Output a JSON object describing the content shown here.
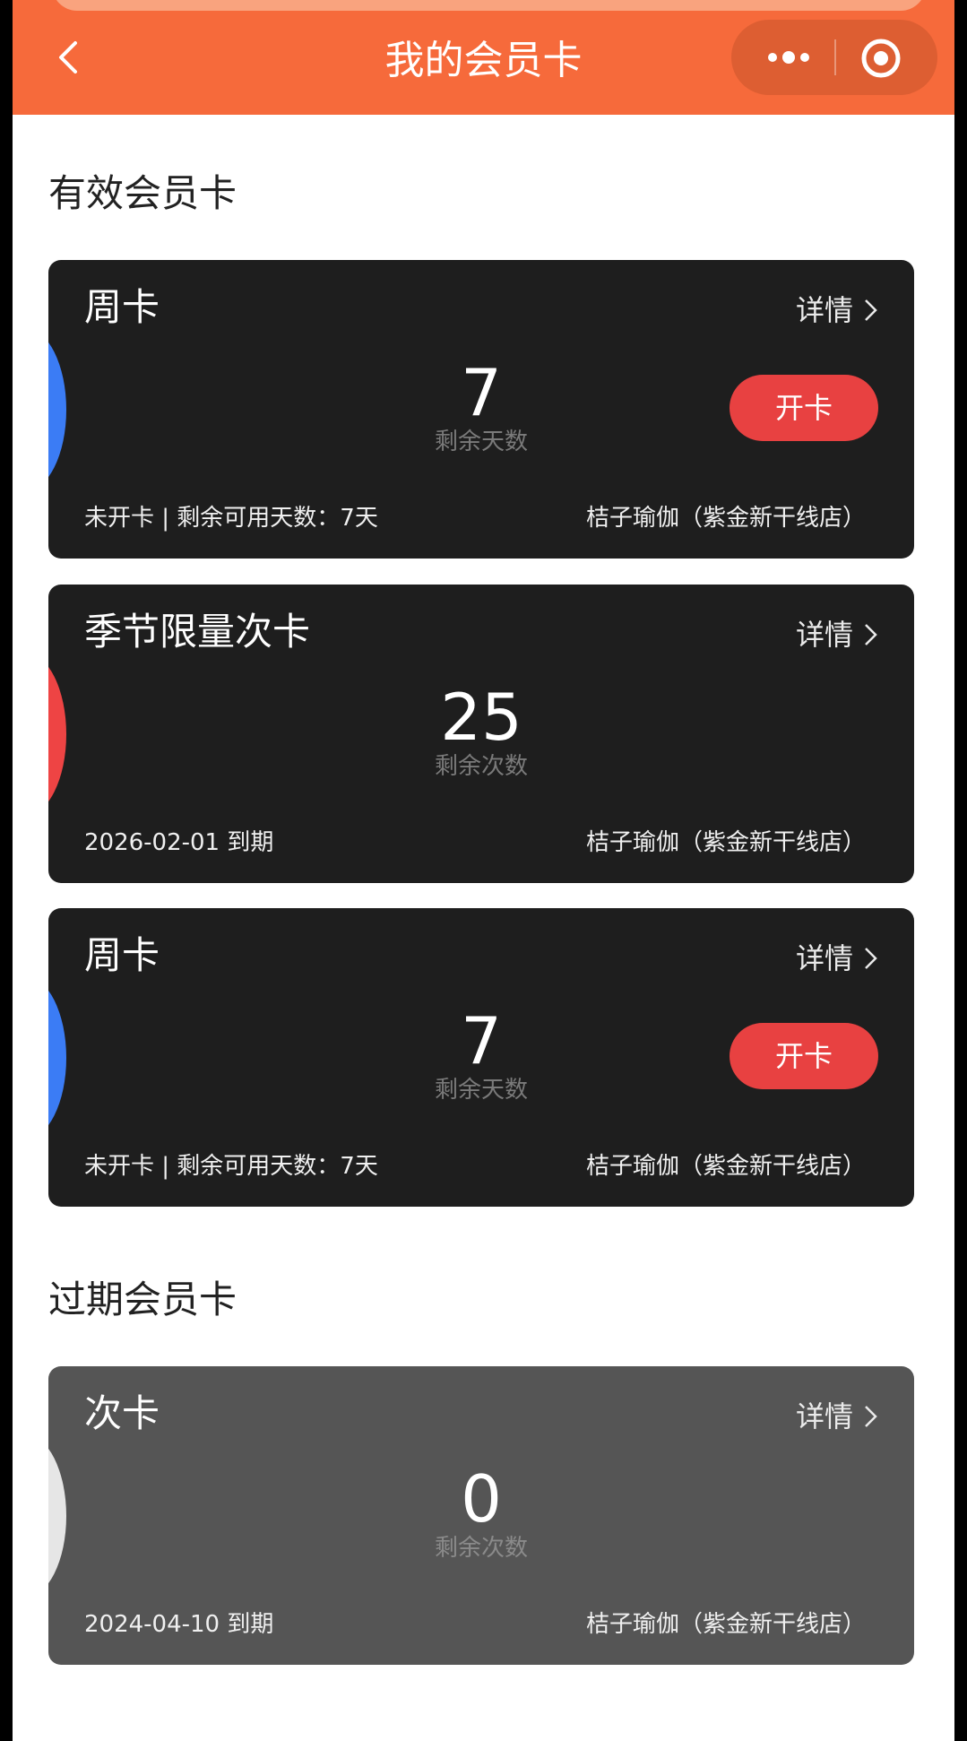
{
  "header": {
    "title": "我的会员卡",
    "back_icon": "chevron-left-icon",
    "more_icon": "ellipsis-icon",
    "close_icon": "target-icon",
    "background": "#f66a3b"
  },
  "sections": {
    "valid_title": "有效会员卡",
    "expired_title": "过期会员卡"
  },
  "cards": [
    {
      "name": "周卡",
      "detail_label": "详情",
      "value": "7",
      "value_label": "剩余天数",
      "open_label": "开卡",
      "status": "未开卡 | 剩余可用天数：7天",
      "store": "桔子瑜伽（紫金新干线店）",
      "accent": "#3b7cf5"
    },
    {
      "name": "季节限量次卡",
      "detail_label": "详情",
      "value": "25",
      "value_label": "剩余次数",
      "status": "2026-02-01 到期",
      "store": "桔子瑜伽（紫金新干线店）",
      "accent": "#ee4444"
    },
    {
      "name": "周卡",
      "detail_label": "详情",
      "value": "7",
      "value_label": "剩余天数",
      "open_label": "开卡",
      "status": "未开卡 | 剩余可用天数：7天",
      "store": "桔子瑜伽（紫金新干线店）",
      "accent": "#3b7cf5"
    }
  ],
  "expired_cards": [
    {
      "name": "次卡",
      "detail_label": "详情",
      "value": "0",
      "value_label": "剩余次数",
      "status": "2024-04-10 到期",
      "store": "桔子瑜伽（紫金新干线店）",
      "accent": "#e6e6e6"
    }
  ],
  "colors": {
    "card_bg": "#1e1e1e",
    "expired_card_bg": "#555555",
    "open_button": "#e84141"
  }
}
